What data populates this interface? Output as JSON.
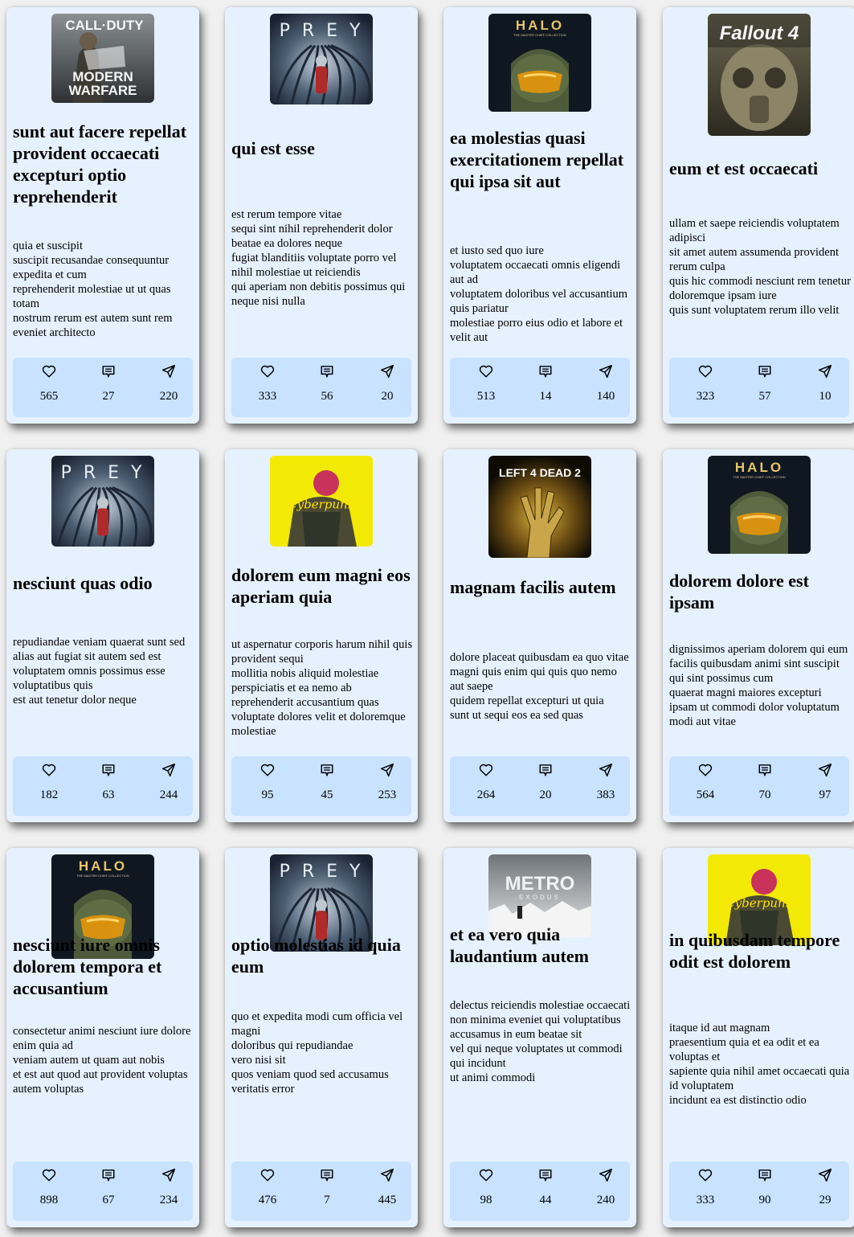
{
  "cards": [
    {
      "image": "call-of-duty-modern-warfare-cover",
      "image_text": [
        "CALL·DUTY",
        "MODERN",
        "WARFARE"
      ],
      "title": "sunt aut facere repellat provident occaecati excepturi optio reprehenderit",
      "body": "quia et suscipit\nsuscipit recusandae consequuntur expedita et cum\nreprehenderit molestiae ut ut quas totam\nnostrum rerum est autem sunt rem eveniet architecto",
      "likes": "565",
      "comments": "27",
      "shares": "220"
    },
    {
      "image": "prey-cover",
      "image_text": [
        "P R E Y"
      ],
      "title": "qui est esse",
      "body": "est rerum tempore vitae\nsequi sint nihil reprehenderit dolor beatae ea dolores neque\nfugiat blanditiis voluptate porro vel nihil molestiae ut reiciendis\nqui aperiam non debitis possimus qui neque nisi nulla",
      "likes": "333",
      "comments": "56",
      "shares": "20"
    },
    {
      "image": "halo-master-chief-collection-cover",
      "image_text": [
        "HALO",
        "THE MASTER CHIEF COLLECTION"
      ],
      "title": "ea molestias quasi exercitationem repellat qui ipsa sit aut",
      "body": "et iusto sed quo iure\nvoluptatem occaecati omnis eligendi aut ad\nvoluptatem doloribus vel accusantium quis pariatur\nmolestiae porro eius odio et labore et velit aut",
      "likes": "513",
      "comments": "14",
      "shares": "140"
    },
    {
      "image": "fallout-4-cover",
      "image_text": [
        "Fallout 4"
      ],
      "title": "eum et est occaecati",
      "body": "ullam et saepe reiciendis voluptatem adipisci\nsit amet autem assumenda provident rerum culpa\nquis hic commodi nesciunt rem tenetur doloremque ipsam iure\nquis sunt voluptatem rerum illo velit",
      "likes": "323",
      "comments": "57",
      "shares": "10"
    },
    {
      "image": "prey-cover",
      "image_text": [
        "P R E Y"
      ],
      "title": "nesciunt quas odio",
      "body": "repudiandae veniam quaerat sunt sed\nalias aut fugiat sit autem sed est\nvoluptatem omnis possimus esse voluptatibus quis\nest aut tenetur dolor neque",
      "likes": "182",
      "comments": "63",
      "shares": "244"
    },
    {
      "image": "cyberpunk-cover",
      "image_text": [
        "Cyberpunk"
      ],
      "title": "dolorem eum magni eos aperiam quia",
      "body": "ut aspernatur corporis harum nihil quis provident sequi\nmollitia nobis aliquid molestiae\nperspiciatis et ea nemo ab reprehenderit accusantium quas\nvoluptate dolores velit et doloremque molestiae",
      "likes": "95",
      "comments": "45",
      "shares": "253"
    },
    {
      "image": "left-4-dead-2-cover",
      "image_text": [
        "LEFT 4 DEAD 2"
      ],
      "title": "magnam facilis autem",
      "body": "dolore placeat quibusdam ea quo vitae\nmagni quis enim qui quis quo nemo aut saepe\nquidem repellat excepturi ut quia\nsunt ut sequi eos ea sed quas",
      "likes": "264",
      "comments": "20",
      "shares": "383"
    },
    {
      "image": "halo-master-chief-collection-cover",
      "image_text": [
        "HALO",
        "THE MASTER CHIEF COLLECTION"
      ],
      "title": "dolorem dolore est ipsam",
      "body": "dignissimos aperiam dolorem qui eum\nfacilis quibusdam animi sint suscipit qui sint possimus cum\nquaerat magni maiores excepturi\nipsam ut commodi dolor voluptatum modi aut vitae",
      "likes": "564",
      "comments": "70",
      "shares": "97"
    },
    {
      "image": "halo-master-chief-collection-cover",
      "image_text": [
        "HALO",
        "THE MASTER CHIEF COLLECTION"
      ],
      "title": "nesciunt iure omnis dolorem tempora et accusantium",
      "body": "consectetur animi nesciunt iure dolore\nenim quia ad\nveniam autem ut quam aut nobis\net est aut quod aut provident voluptas autem voluptas",
      "likes": "898",
      "comments": "67",
      "shares": "234"
    },
    {
      "image": "prey-cover",
      "image_text": [
        "P R E Y"
      ],
      "title": "optio molestias id quia eum",
      "body": "quo et expedita modi cum officia vel magni\ndoloribus qui repudiandae\nvero nisi sit\nquos veniam quod sed accusamus veritatis error",
      "likes": "476",
      "comments": "7",
      "shares": "445"
    },
    {
      "image": "metro-exodus-cover",
      "image_text": [
        "METRO",
        "EXODUS"
      ],
      "title": "et ea vero quia laudantium autem",
      "body": "delectus reiciendis molestiae occaecati non minima eveniet qui voluptatibus\naccusamus in eum beatae sit\nvel qui neque voluptates ut commodi qui incidunt\nut animi commodi",
      "likes": "98",
      "comments": "44",
      "shares": "240"
    },
    {
      "image": "cyberpunk-cover",
      "image_text": [
        "Cyberpunk"
      ],
      "title": "in quibusdam tempore odit est dolorem",
      "body": "itaque id aut magnam\npraesentium quia et ea odit et ea voluptas et\nsapiente quia nihil amet occaecati quia id voluptatem\nincidunt ea est distinctio odio",
      "likes": "333",
      "comments": "90",
      "shares": "29"
    }
  ],
  "icons": {
    "likes": "heart-icon",
    "comments": "comment-icon",
    "shares": "send-icon"
  },
  "colors": {
    "page_background": "#f0f0f0",
    "card_background": "#e6f1ff",
    "stats_background": "#c8e2ff"
  }
}
